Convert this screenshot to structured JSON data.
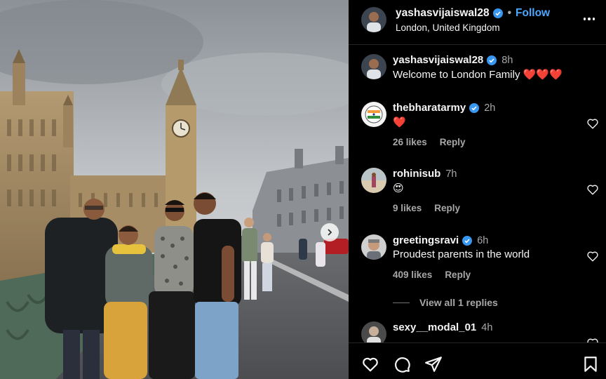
{
  "post": {
    "username": "yashasvijaiswal28",
    "separator": "•",
    "follow_label": "Follow",
    "location": "London, United Kingdom",
    "caption": {
      "username": "yashasvijaiswal28",
      "time": "8h",
      "text": "Welcome to London Family ❤️❤️❤️"
    }
  },
  "comments": [
    {
      "username": "thebharatarmy",
      "verified": true,
      "time": "2h",
      "text": "❤️",
      "likes": "26 likes",
      "reply_label": "Reply"
    },
    {
      "username": "rohinisub",
      "verified": false,
      "time": "7h",
      "text": "😍",
      "likes": "9 likes",
      "reply_label": "Reply"
    },
    {
      "username": "greetingsravi",
      "verified": true,
      "time": "6h",
      "text": "Proudest parents in the world",
      "likes": "409 likes",
      "reply_label": "Reply"
    },
    {
      "username": "sexy__modal_01",
      "verified": false,
      "time": "4h",
      "text": ""
    }
  ],
  "view_replies_label": "View all 1 replies",
  "icons": {
    "verified": "verified-badge-icon",
    "more": "more-options-icon",
    "like": "heart-icon",
    "comment": "comment-icon",
    "share": "share-icon",
    "save": "bookmark-icon",
    "next": "chevron-right-icon"
  },
  "colors": {
    "accent": "#4aa8ff",
    "background": "#000000",
    "verified": "#3897f0",
    "muted": "#a8a8a8"
  }
}
